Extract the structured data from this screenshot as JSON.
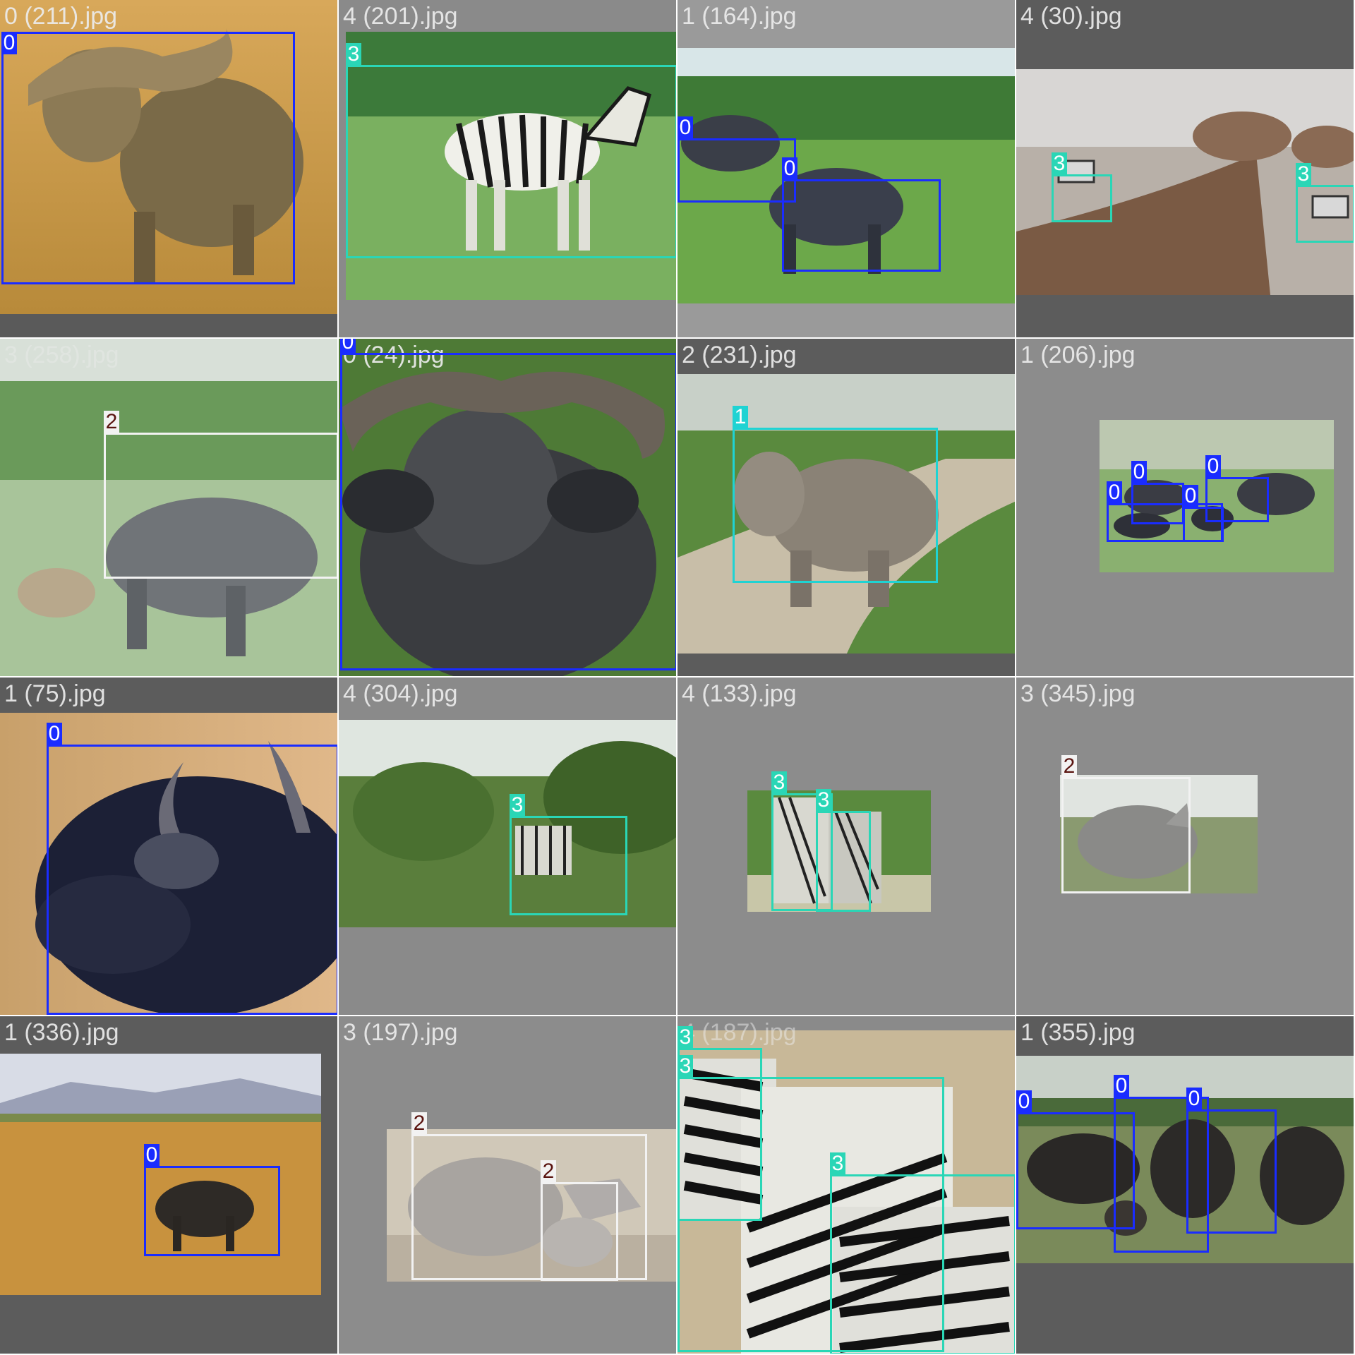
{
  "class_colors": {
    "0": "#1a2cff",
    "1": "#1fd3d3",
    "2": "#f2f2f2",
    "3": "#2ad6b6"
  },
  "label_text_colors": {
    "0": "#ffffff",
    "1": "#ffffff",
    "2": "#5a1410",
    "3": "#ffffff"
  },
  "tiles": [
    {
      "filename": "0 (211).jpg",
      "scene": "buffalo-golden-grass",
      "boxes": [
        {
          "cls": "0"
        }
      ]
    },
    {
      "filename": "4 (201).jpg",
      "scene": "zebra-grass",
      "boxes": [
        {
          "cls": "3"
        }
      ]
    },
    {
      "filename": "1 (164).jpg",
      "scene": "buffaloes-palms",
      "boxes": [
        {
          "cls": "0"
        },
        {
          "cls": "0"
        }
      ]
    },
    {
      "filename": "4 (30).jpg",
      "scene": "zoo-enclosure-zebras",
      "boxes": [
        {
          "cls": "3"
        },
        {
          "cls": "3"
        }
      ]
    },
    {
      "filename": "3 (258).jpg",
      "scene": "rhino-hyena-bush",
      "boxes": [
        {
          "cls": "2"
        }
      ]
    },
    {
      "filename": "0 (24).jpg",
      "scene": "buffalo-closeup",
      "boxes": [
        {
          "cls": "0"
        }
      ]
    },
    {
      "filename": "2 (231).jpg",
      "scene": "elephant-road",
      "boxes": [
        {
          "cls": "1"
        }
      ]
    },
    {
      "filename": "1 (206).jpg",
      "scene": "buffalo-herd-small",
      "boxes": [
        {
          "cls": "0"
        },
        {
          "cls": "0"
        },
        {
          "cls": "0"
        },
        {
          "cls": "0"
        }
      ]
    },
    {
      "filename": "1 (75).jpg",
      "scene": "buffalo-head-dark",
      "boxes": [
        {
          "cls": "0"
        }
      ]
    },
    {
      "filename": "4 (304).jpg",
      "scene": "zebra-bush",
      "boxes": [
        {
          "cls": "3"
        }
      ]
    },
    {
      "filename": "4 (133).jpg",
      "scene": "zebras-fighting",
      "boxes": [
        {
          "cls": "3"
        },
        {
          "cls": "3"
        }
      ]
    },
    {
      "filename": "3 (345).jpg",
      "scene": "rhino-small",
      "boxes": [
        {
          "cls": "2"
        }
      ]
    },
    {
      "filename": "1 (336).jpg",
      "scene": "buffalo-savanna",
      "boxes": [
        {
          "cls": "0"
        }
      ]
    },
    {
      "filename": "3 (197).jpg",
      "scene": "rhino-and-calf",
      "boxes": [
        {
          "cls": "2"
        },
        {
          "cls": "2"
        }
      ]
    },
    {
      "filename": "4 (187).jpg",
      "scene": "zebras-closeup",
      "boxes": [
        {
          "cls": "3"
        },
        {
          "cls": "3"
        },
        {
          "cls": "3"
        }
      ]
    },
    {
      "filename": "1 (355).jpg",
      "scene": "buffalo-group",
      "boxes": [
        {
          "cls": "0"
        },
        {
          "cls": "0"
        },
        {
          "cls": "0"
        }
      ]
    }
  ]
}
